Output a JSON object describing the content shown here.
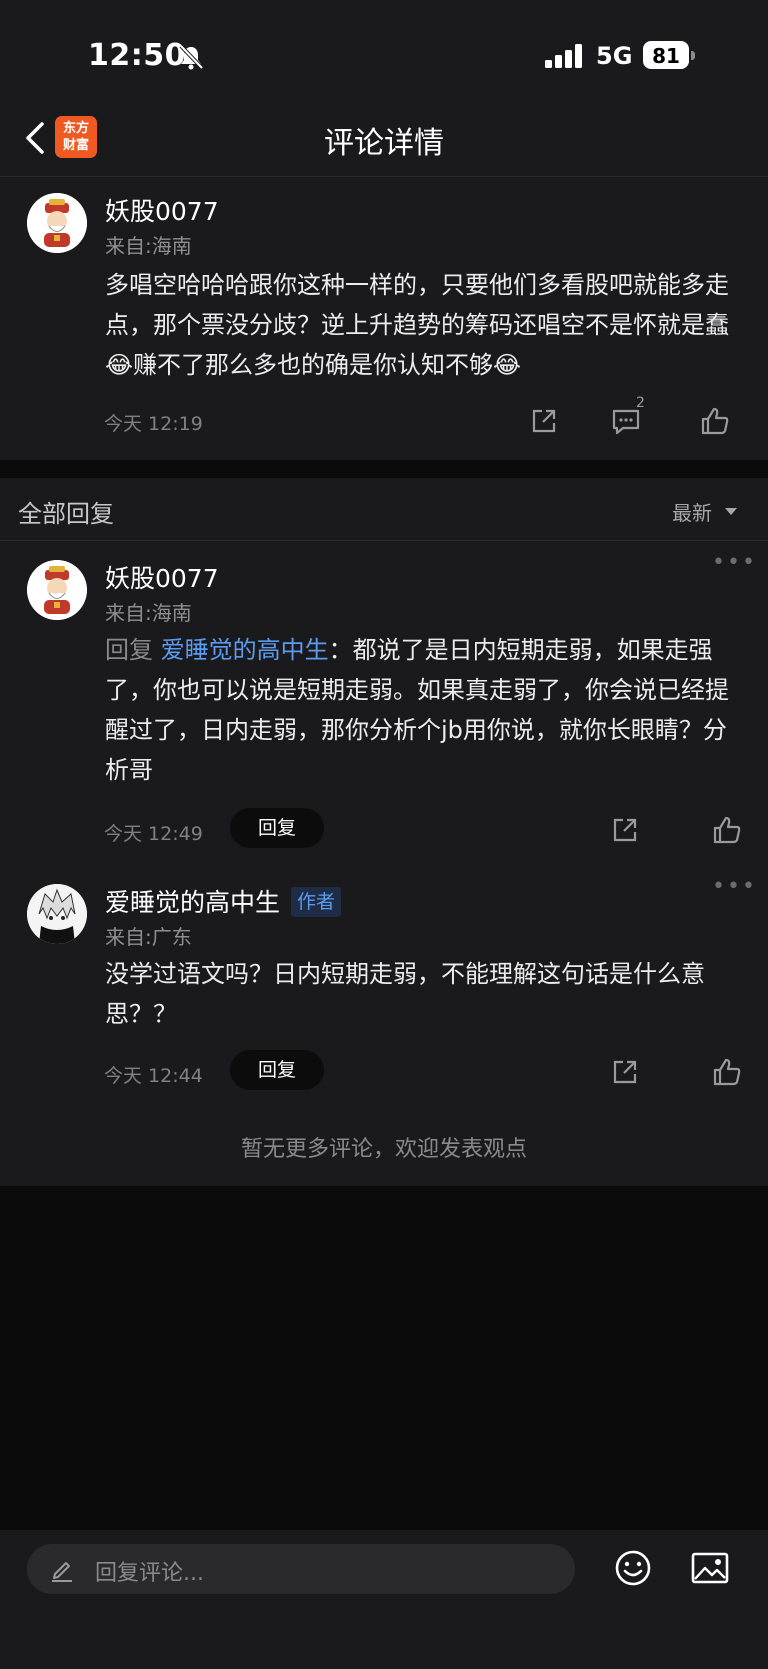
{
  "status_bar": {
    "time": "12:50",
    "network": "5G",
    "battery": "81"
  },
  "nav": {
    "title": "评论详情",
    "logo_line1": "东方",
    "logo_line2": "财富"
  },
  "main_comment": {
    "username": "妖股0077",
    "location": "来自:海南",
    "content": "多唱空哈哈哈跟你这种一样的，只要他们多看股吧就能多走点，那个票没分歧？逆上升趋势的筹码还唱空不是怀就是蠢😂赚不了那么多也的确是你认知不够😂",
    "time": "今天 12:19",
    "comment_count": "2"
  },
  "replies_header": {
    "title": "全部回复",
    "sort": "最新"
  },
  "replies": [
    {
      "username": "妖股0077",
      "location": "来自:海南",
      "reply_prefix": "回复 ",
      "mention": "爱睡觉的高中生",
      "content": "：都说了是日内短期走弱，如果走强了，你也可以说是短期走弱。如果真走弱了，你会说已经提醒过了，日内走弱，那你分析个jb用你说，就你长眼睛？分析哥",
      "time": "今天 12:49",
      "reply_label": "回复"
    },
    {
      "username": "爱睡觉的高中生",
      "author_badge": "作者",
      "location": "来自:广东",
      "content": "没学过语文吗？日内短期走弱，不能理解这句话是什么意思？？",
      "time": "今天 12:44",
      "reply_label": "回复"
    }
  ],
  "footer_note": "暂无更多评论，欢迎发表观点",
  "bottom_bar": {
    "placeholder": "回复评论..."
  },
  "icons": {
    "more": "more-dots-icon",
    "share": "share-icon",
    "comment": "comment-icon",
    "like": "thumbs-up-icon",
    "emoji": "emoji-icon",
    "image": "image-icon",
    "pencil": "pencil-icon"
  },
  "colors": {
    "background": "#1a1a1c",
    "accent_link": "#5b9bf0",
    "logo": "#f05a22"
  }
}
